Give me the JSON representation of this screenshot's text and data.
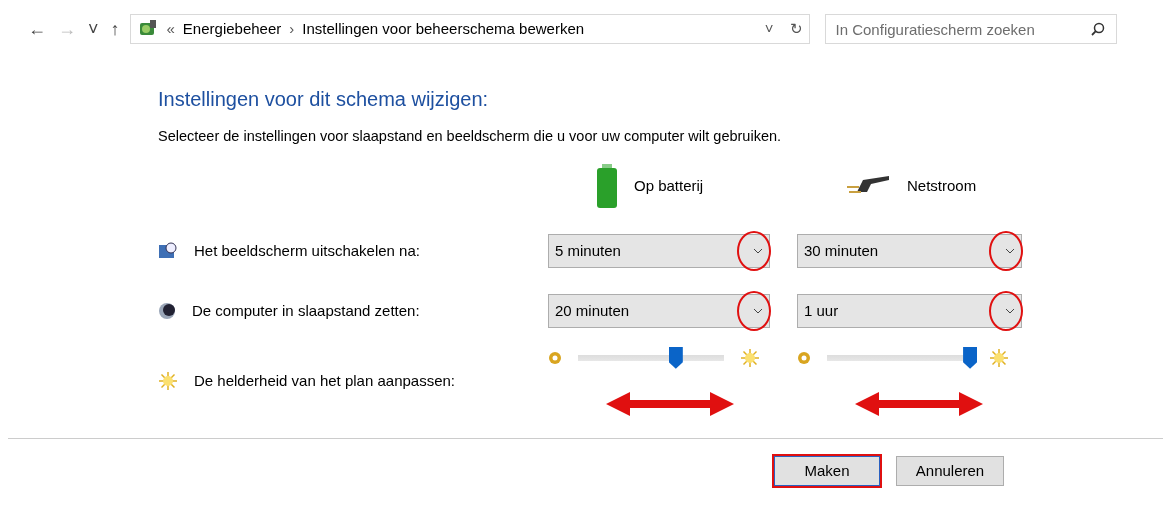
{
  "nav": {
    "buttons": [
      {
        "glyph": "←",
        "disabled": false
      },
      {
        "glyph": "→",
        "disabled": true
      },
      {
        "glyph": "˅",
        "disabled": false
      },
      {
        "glyph": "↑",
        "disabled": false
      }
    ]
  },
  "address_bar": {
    "crumbs": [
      {
        "kind": "chevron",
        "text": "«"
      },
      {
        "kind": "link",
        "text": "Energiebeheer"
      },
      {
        "kind": "separator",
        "text": "›"
      },
      {
        "kind": "link",
        "text": "Instellingen voor beheerschema bewerken"
      }
    ],
    "dropdown": "˅",
    "refresh": "↻"
  },
  "search": {
    "placeholder": "In Configuratiescherm zoeken"
  },
  "title": "Instellingen voor dit schema wijzigen:",
  "subtitle": "Selecteer de instellingen voor slaapstand en beeldscherm die u voor uw computer wilt gebruiken.",
  "columns": [
    {
      "label": "Op batterij"
    },
    {
      "label": "Netstroom"
    }
  ],
  "rows": [
    {
      "kind": "select",
      "label": "Het beeldscherm uitschakelen na:",
      "cells": [
        {
          "value": "5 minuten",
          "circled": true
        },
        {
          "value": "30 minuten",
          "circled": true
        }
      ]
    },
    {
      "kind": "select",
      "label": "De computer in slaapstand zetten:",
      "cells": [
        {
          "value": "20 minuten",
          "circled": true
        },
        {
          "value": "1 uur",
          "circled": true
        }
      ]
    },
    {
      "kind": "slider",
      "label": "De helderheid van het plan aanpassen:",
      "cells": [
        {
          "level": 0.67,
          "arrow": true
        },
        {
          "level": 0.98,
          "arrow": true
        }
      ]
    }
  ],
  "buttons": [
    {
      "label": "Maken",
      "highlighted": true
    },
    {
      "label": "Annuleren",
      "highlighted": false
    }
  ]
}
